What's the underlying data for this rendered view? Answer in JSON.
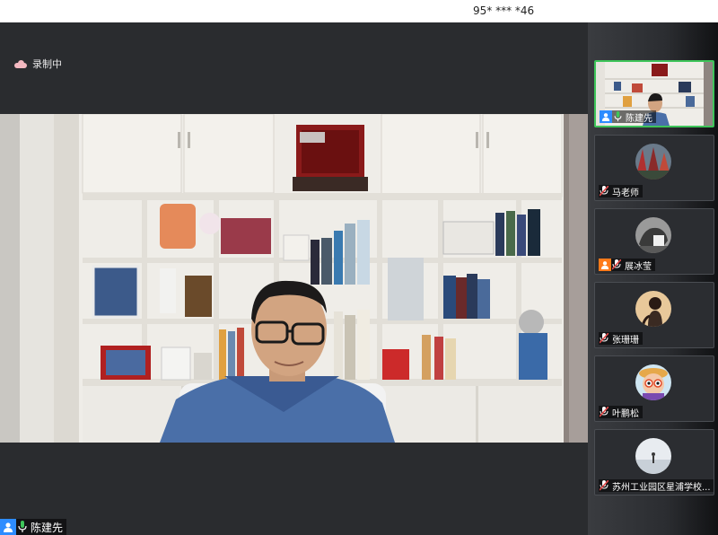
{
  "meeting": {
    "id_text": "95* *** *46"
  },
  "recording": {
    "label": "录制中",
    "icon": "cloud-icon"
  },
  "main_video": {
    "name": "陈建先",
    "mic": "mic-on-icon",
    "avatar_icon": "person-icon"
  },
  "colors": {
    "accent_blue": "#2d8cff",
    "accent_green": "#3ec55a",
    "muted_red": "#e04a4a",
    "avatar_orange": "#ff7a1a",
    "recording_pink": "#f3b8c0"
  },
  "participants": [
    {
      "name": "陈建先",
      "mic": "mic-on-icon",
      "has_badge": true,
      "badge_color": "#2d8cff",
      "active": true
    },
    {
      "name": "马老师",
      "mic": "mic-muted-icon",
      "has_badge": false
    },
    {
      "name": "展冰莹",
      "mic": "mic-muted-icon",
      "has_badge": true,
      "badge_color": "#ff7a1a"
    },
    {
      "name": "张珊珊",
      "mic": "mic-muted-icon",
      "has_badge": false
    },
    {
      "name": "叶鹏松",
      "mic": "mic-muted-icon",
      "has_badge": false
    },
    {
      "name": "苏州工业园区星浦学校...",
      "mic": "mic-muted-icon",
      "has_badge": false
    }
  ]
}
